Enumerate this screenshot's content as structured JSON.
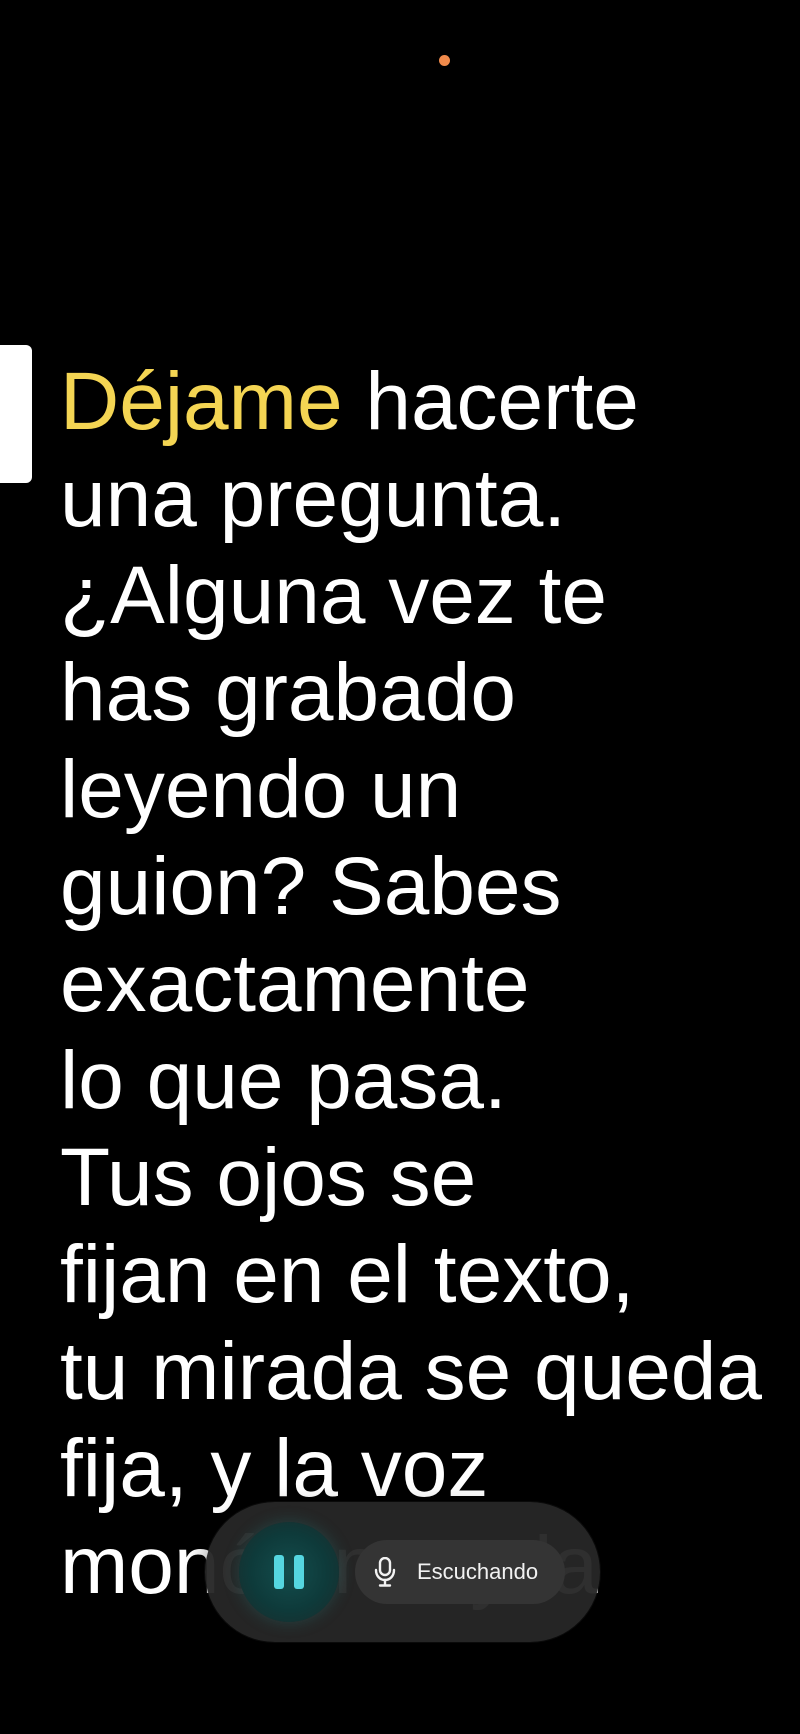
{
  "teleprompter": {
    "lines": [
      {
        "highlight": "Déjame",
        "rest": " hacerte"
      },
      "una pregunta.",
      "¿Alguna vez te",
      "has grabado",
      "leyendo un",
      "guion? Sabes",
      "exactamente",
      "lo que pasa.",
      "Tus ojos se",
      "fijan en el texto,",
      "tu mirada se queda",
      "fija, y la voz",
      "monótona, y la"
    ],
    "highlight_color": "#f4d553",
    "text_color": "#ffffff",
    "background_color": "#000000"
  },
  "controls": {
    "pause_icon": "pause-icon",
    "pause_color": "#55d6e0",
    "mic_icon": "microphone-icon",
    "listening_label": "Escuchando"
  },
  "status": {
    "indicator_color": "#f08a4b"
  }
}
